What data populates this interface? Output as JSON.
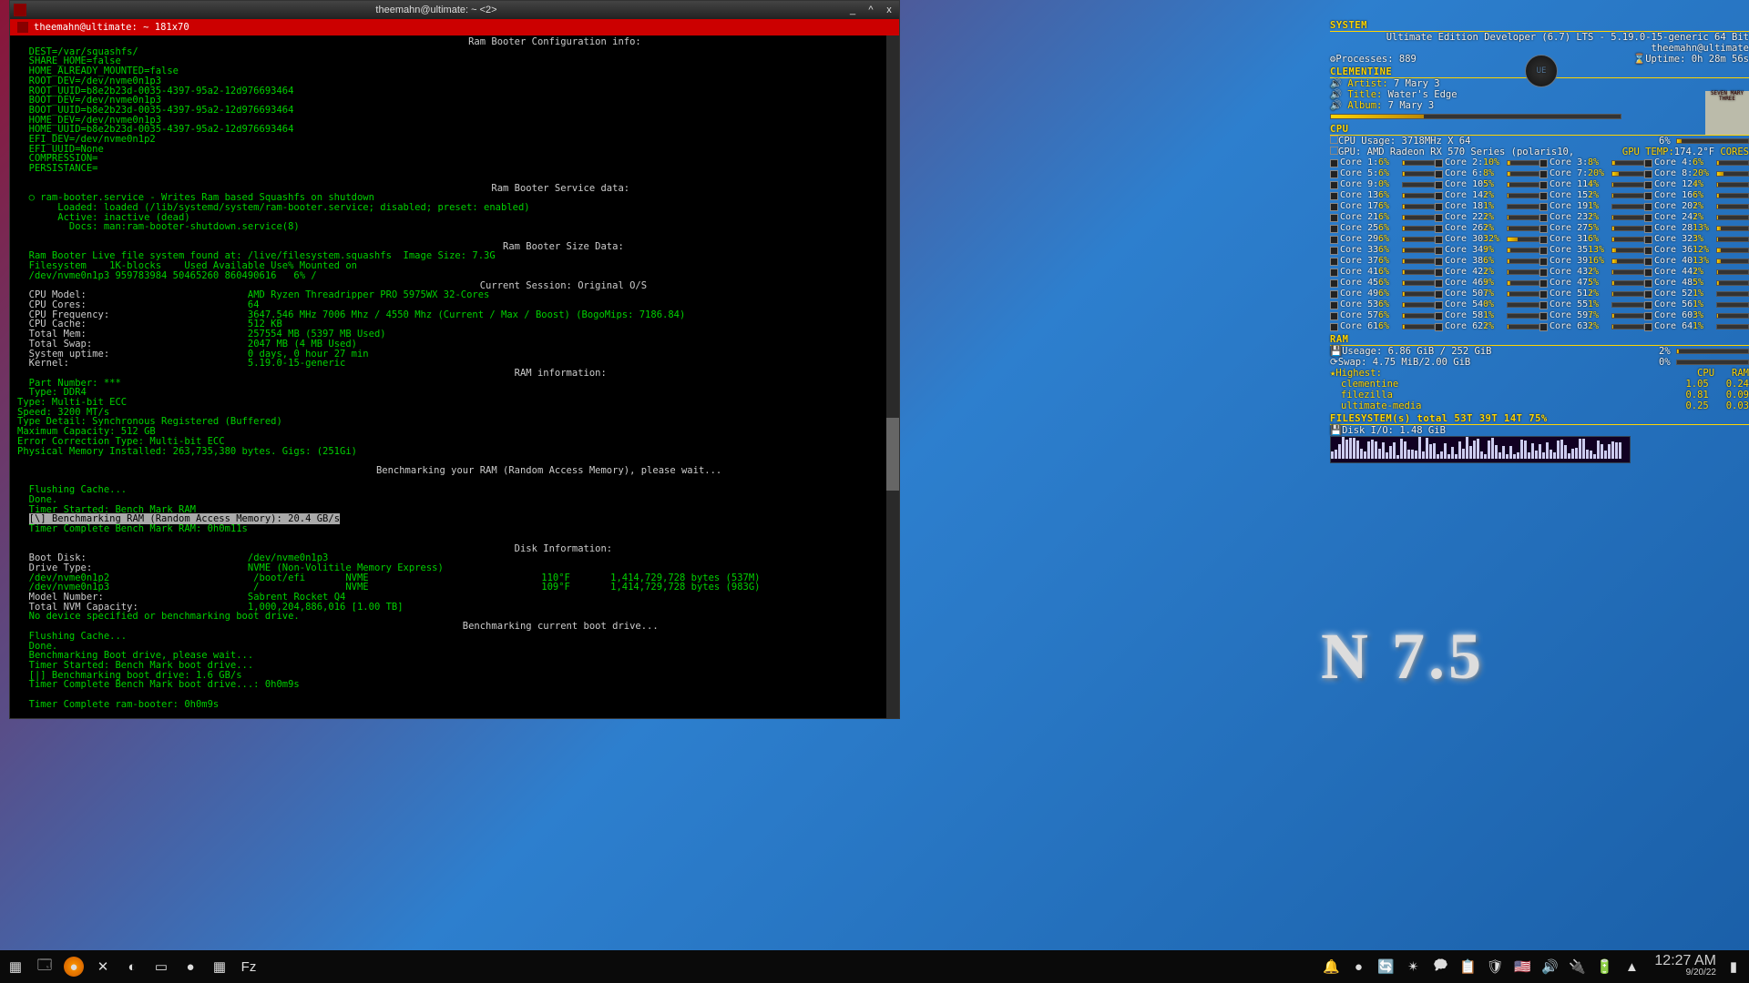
{
  "window": {
    "title": "theemahn@ultimate: ~ <2>",
    "tab": "theemahn@ultimate: ~ 181x70",
    "prompt_user": "theemahn@ultimate",
    "prompt_path": "~",
    "prompt_sfx": "$"
  },
  "ctrls": {
    "min": "_",
    "max": "^",
    "close": "x"
  },
  "term": {
    "hdr1": "Ram Booter Configuration info:",
    "cfg": [
      "DEST=/var/squashfs/",
      "SHARE_HOME=false",
      "HOME_ALREADY_MOUNTED=false",
      "ROOT_DEV=/dev/nvme0n1p3",
      "ROOT_UUID=b8e2b23d-0035-4397-95a2-12d976693464",
      "BOOT_DEV=/dev/nvme0n1p3",
      "BOOT_UUID=b8e2b23d-0035-4397-95a2-12d976693464",
      "HOME_DEV=/dev/nvme0n1p3",
      "HOME_UUID=b8e2b23d-0035-4397-95a2-12d976693464",
      "EFI_DEV=/dev/nvme0n1p2",
      "EFI_UUID=None",
      "COMPRESSION=",
      "PERSISTANCE="
    ],
    "hdr2": "Ram Booter Service data:",
    "svc": [
      "○ ram-booter.service - Writes Ram based Squashfs on shutdown",
      "     Loaded: loaded (/lib/systemd/system/ram-booter.service; disabled; preset: enabled)",
      "     Active: inactive (dead)",
      "       Docs: man:ram-booter-shutdown.service(8)"
    ],
    "hdr3": "Ram Booter Size Data:",
    "sz": [
      "Ram Booter Live file system found at: /live/filesystem.squashfs  Image Size: 7.3G",
      "Filesystem    1K-blocks    Used Available Use% Mounted on",
      "/dev/nvme0n1p3 959783984 50465260 860490616   6% /"
    ],
    "hdr4": "Current Session: Original O/S",
    "sess": [
      [
        "CPU Model:",
        "AMD Ryzen Threadripper PRO 5975WX 32-Cores"
      ],
      [
        "CPU Cores:",
        "64"
      ],
      [
        "CPU Frequency:",
        "3647.546 MHz 7006 Mhz / 4550 Mhz (Current / Max / Boost) (BogoMips: 7186.84)"
      ],
      [
        "CPU Cache:",
        "512 KB"
      ],
      [
        "Total Mem:",
        "257554 MB (5397 MB Used)"
      ],
      [
        "Total Swap:",
        "2047 MB (4 MB Used)"
      ],
      [
        "System uptime:",
        "0 days, 0 hour 27 min"
      ],
      [
        "Kernel:",
        "5.19.0-15-generic"
      ]
    ],
    "hdr5": "RAM information:",
    "ram": [
      "Part Number: ***",
      "Type: DDR4",
      "Type: Multi-bit ECC",
      "Speed: 3200 MT/s",
      "Type Detail: Synchronous Registered (Buffered)",
      "Maximum Capacity: 512 GB",
      "Error Correction Type: Multi-bit ECC",
      "Physical Memory Installed: 263,735,380 bytes. Gigs: (251Gi)"
    ],
    "hdr6": "Benchmarking your RAM (Random Access Memory), please wait...",
    "bench": [
      "Flushing Cache...",
      "Done.",
      "Timer Started: Bench Mark RAM"
    ],
    "benchhl": "[\\] Benchmarking RAM (Random Access Memory): 20.4 GB/s",
    "bench2": "Timer Complete Bench Mark RAM: 0h0m11s",
    "hdr7": "Disk Information:",
    "disk": [
      [
        "Boot Disk:",
        "/dev/nvme0n1p3"
      ],
      [
        "Drive Type:",
        "NVME (Non-Volitile Memory Express)"
      ]
    ],
    "disklines": [
      "/dev/nvme0n1p2                         /boot/efi       NVME                              110°F       1,414,729,728 bytes (537M)",
      "/dev/nvme0n1p3                         /               NVME                              109°F       1,414,729,728 bytes (983G)"
    ],
    "disk2": [
      [
        "Model Number:",
        "Sabrent Rocket Q4"
      ],
      [
        "Total NVM Capacity:",
        "1,000,204,886,016 [1.00 TB]"
      ]
    ],
    "disk3": "No device specified or benchmarking boot drive.",
    "hdr8": "Benchmarking current boot drive...",
    "boot": [
      "Flushing Cache...",
      "Done.",
      "Benchmarking Boot drive, please wait...",
      "Timer Started: Bench Mark boot drive...",
      "[|] Benchmarking boot drive: 1.6 GB/s",
      "Timer Complete Bench Mark boot drive...: 0h0m9s"
    ],
    "done": "Timer Complete ram-booter: 0h0m9s"
  },
  "conky": {
    "system_hdr": "SYSTEM",
    "distro": "Ultimate Edition Developer (6.7) LTS - 5.19.0-15-generic 64 Bit",
    "userhost": "theemahn@ultimate",
    "proc_lbl": "Processes:",
    "proc_val": "889",
    "uptime_lbl": "Uptime:",
    "uptime_val": "0h 28m 56s",
    "clem_hdr": "CLEMENTINE",
    "artist_lbl": "Artist:",
    "artist_val": "7 Mary 3",
    "title_lbl": "Title:",
    "title_val": "Water's Edge",
    "album_lbl": "Album:",
    "album_val": "7 Mary 3",
    "album_art": "SEVEN MARY THREE",
    "cpu_hdr": "CPU",
    "cpu_usage_lbl": "CPU Usage:",
    "cpu_usage_val": "3718MHz X 64",
    "cpu_usage_pct": "6%",
    "gpu_lbl": "GPU:",
    "gpu_val": "AMD Radeon RX 570 Series (polaris10,",
    "gputemp_lbl": "GPU TEMP:",
    "gputemp_val": "174.2°F",
    "cores_hdr": "CORES",
    "coresA": [
      [
        "Core 1:",
        6
      ],
      [
        "Core 2:",
        10
      ],
      [
        "Core 3:",
        8
      ],
      [
        "Core 4:",
        6
      ],
      [
        "Core 5:",
        6
      ],
      [
        "Core 6:",
        8
      ],
      [
        "Core 7:",
        20
      ],
      [
        "Core 8:",
        20
      ],
      [
        "Core 9:",
        0
      ],
      [
        "Core 10:",
        5
      ],
      [
        "Core 11:",
        4
      ],
      [
        "Core 12:",
        4
      ],
      [
        "Core 13:",
        6
      ],
      [
        "Core 14:",
        2
      ],
      [
        "Core 15:",
        2
      ],
      [
        "Core 16:",
        6
      ],
      [
        "Core 17:",
        6
      ],
      [
        "Core 18:",
        1
      ],
      [
        "Core 19:",
        1
      ],
      [
        "Core 20:",
        2
      ],
      [
        "Core 21:",
        6
      ],
      [
        "Core 22:",
        2
      ],
      [
        "Core 23:",
        2
      ],
      [
        "Core 24:",
        2
      ],
      [
        "Core 25:",
        6
      ],
      [
        "Core 26:",
        2
      ],
      [
        "Core 27:",
        5
      ],
      [
        "Core 28:",
        13
      ],
      [
        "Core 29:",
        6
      ],
      [
        "Core 30:",
        32
      ],
      [
        "Core 31:",
        6
      ],
      [
        "Core 32:",
        3
      ],
      [
        "Core 33:",
        6
      ],
      [
        "Core 34:",
        9
      ],
      [
        "Core 35:",
        13
      ],
      [
        "Core 36:",
        12
      ],
      [
        "Core 37:",
        6
      ],
      [
        "Core 38:",
        6
      ],
      [
        "Core 39:",
        16
      ],
      [
        "Core 40:",
        13
      ],
      [
        "Core 41:",
        6
      ],
      [
        "Core 42:",
        2
      ],
      [
        "Core 43:",
        2
      ],
      [
        "Core 44:",
        2
      ],
      [
        "Core 45:",
        6
      ],
      [
        "Core 46:",
        9
      ],
      [
        "Core 47:",
        5
      ],
      [
        "Core 48:",
        5
      ],
      [
        "Core 49:",
        6
      ],
      [
        "Core 50:",
        7
      ],
      [
        "Core 51:",
        2
      ],
      [
        "Core 52:",
        1
      ],
      [
        "Core 53:",
        6
      ],
      [
        "Core 54:",
        0
      ],
      [
        "Core 55:",
        1
      ],
      [
        "Core 56:",
        1
      ],
      [
        "Core 57:",
        6
      ],
      [
        "Core 58:",
        1
      ],
      [
        "Core 59:",
        7
      ],
      [
        "Core 60:",
        3
      ],
      [
        "Core 61:",
        6
      ],
      [
        "Core 62:",
        2
      ],
      [
        "Core 63:",
        2
      ],
      [
        "Core 64:",
        1
      ]
    ],
    "ram_hdr": "RAM",
    "useage_lbl": "Useage:",
    "useage_val": "6.86 GiB / 252 GiB",
    "useage_pct": "2%",
    "swap_lbl": "Swap:",
    "swap_val": "4.75 MiB/2.00 GiB",
    "swap_pct": "0%",
    "highest_lbl": "Highest:",
    "cpu_col": "CPU",
    "ram_col": "RAM",
    "procs": [
      [
        "clementine",
        "1.05",
        "0.24"
      ],
      [
        "filezilla",
        "0.81",
        "0.09"
      ],
      [
        "ultimate-media",
        "0.25",
        "0.03"
      ]
    ],
    "fs_hdr": "FILESYSTEM(s) total 53T 39T 14T 75%",
    "diskio_lbl": "Disk I/O:",
    "diskio_val": "1.48 GiB"
  },
  "brand": "N 7.5",
  "taskbar": {
    "icons_left": [
      "▦",
      "🗔",
      "●",
      "✕",
      "◐",
      "▭",
      "●",
      "▦",
      "Fz"
    ],
    "icons_right": [
      "🔔",
      "●",
      "🔄",
      "✴",
      "🗭",
      "📋",
      "🛡",
      "🇺🇸",
      "🔊",
      "🔌",
      "🔋",
      "▲"
    ],
    "time": "12:27 AM",
    "date": "9/20/22"
  }
}
